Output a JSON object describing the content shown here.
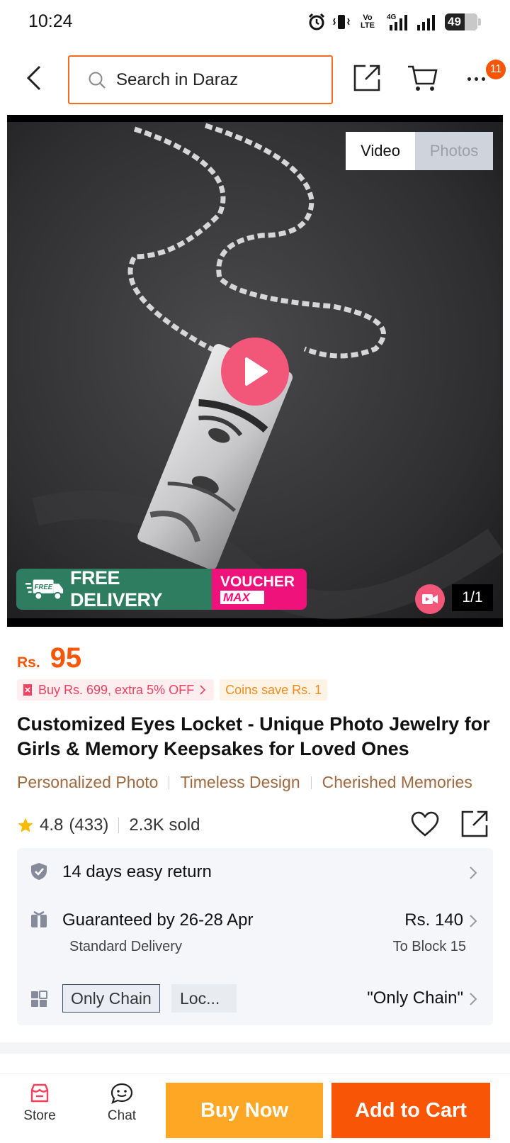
{
  "status_bar": {
    "time": "10:24",
    "volte": "Vo LTE",
    "network": "4G",
    "battery": "49",
    "battery_percent": 49
  },
  "top_bar": {
    "search_placeholder": "Search in Daraz",
    "cart_badge": "11"
  },
  "media": {
    "toggle_video": "Video",
    "toggle_photos": "Photos",
    "active_tab": "Video",
    "banner_free": "FREE DELIVERY",
    "banner_free_icon_text": "FREE",
    "banner_voucher_line1": "VOUCHER",
    "banner_voucher_line2": "MAX",
    "counter": "1/1"
  },
  "product": {
    "currency": "Rs.",
    "price": "95",
    "promo_voucher": "Buy Rs. 699, extra 5% OFF",
    "promo_coins": "Coins save Rs. 1",
    "title": "Customized Eyes Locket - Unique Photo Jewelry for Girls & Memory Keepsakes for Loved Ones",
    "tags": [
      "Personalized Photo",
      "Timeless Design",
      "Cherished Memories"
    ],
    "rating": "4.8",
    "reviews": "(433)",
    "sold": "2.3K sold"
  },
  "info": {
    "return_text": "14 days easy return",
    "delivery_text": "Guaranteed by 26-28 Apr",
    "delivery_sub": "Standard Delivery",
    "delivery_price": "Rs. 140",
    "delivery_location": "To Block 15",
    "variant_selected": "Only Chain",
    "variant_other": "Loc...",
    "variant_value": "\"Only Chain\""
  },
  "bottom_bar": {
    "store": "Store",
    "chat": "Chat",
    "buy_now": "Buy Now",
    "add_to_cart": "Add to Cart"
  },
  "colors": {
    "brand_orange": "#f85606",
    "buy_now_yellow": "#fea725",
    "search_border": "#f36d21",
    "free_delivery_green": "#2f7d60",
    "voucher_pink": "#f0127b",
    "play_pink": "#f25678"
  }
}
